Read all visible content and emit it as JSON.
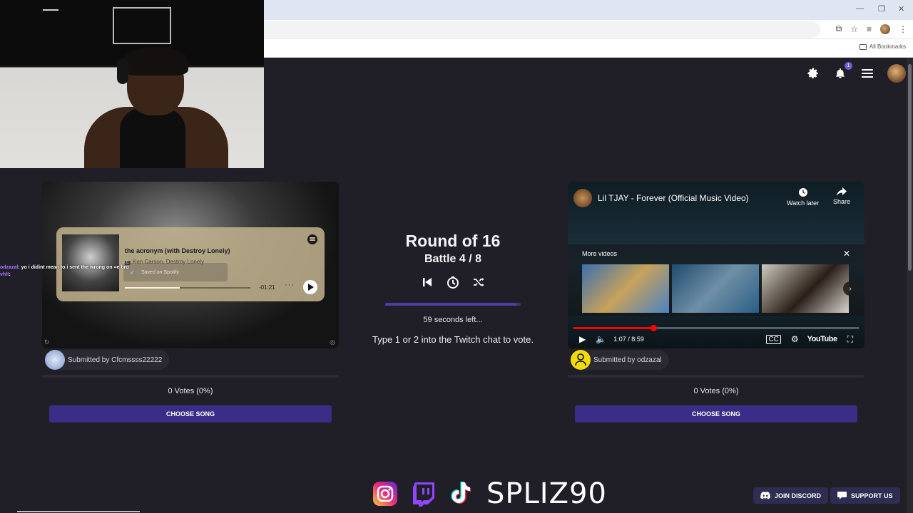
{
  "browser": {
    "bookmarks_label": "All Bookmarks"
  },
  "nav": {
    "notification_count": "1"
  },
  "battle": {
    "round": "Round of 16",
    "battle": "Battle 4 / 8",
    "timer_text": "59 seconds left...",
    "timer_progress": 0.97,
    "instruction": "Type 1 or 2 into the Twitch chat to vote."
  },
  "left_song": {
    "spotify_title": "the acronym (with Destroy Lonely)",
    "spotify_artist": "Ken Carson, Destroy Lonely",
    "explicit_badge": "E",
    "saved_text": "Saved on Spotify",
    "time_remaining": "-01:21",
    "progress": 0.44,
    "submitted_by": "Submitted by Cfcmssss22222",
    "votes": "0 Votes (0%)",
    "choose_label": "CHOOSE SONG"
  },
  "right_song": {
    "video_title": "Lil TJAY - Forever (Official Music Video)",
    "watch_later": "Watch later",
    "share": "Share",
    "more_videos": "More videos",
    "time": "1:07 / 8:59",
    "youtube": "YouTube",
    "submitted_by": "Submitted by odzazal",
    "votes": "0 Votes (0%)",
    "choose_label": "CHOOSE SONG"
  },
  "chat": [
    {
      "name": "odzazal",
      "message": ": yo i didint mean to i sent the wrong on =e bro"
    },
    {
      "name": "vhlt",
      "message": ":"
    }
  ],
  "footer": {
    "brand": "SPLIZ90",
    "discord": "JOIN DISCORD",
    "support": "SUPPORT US"
  },
  "colors": {
    "background": "#201f27",
    "accent": "#3a2d87",
    "youtube_red": "#ff0000"
  }
}
